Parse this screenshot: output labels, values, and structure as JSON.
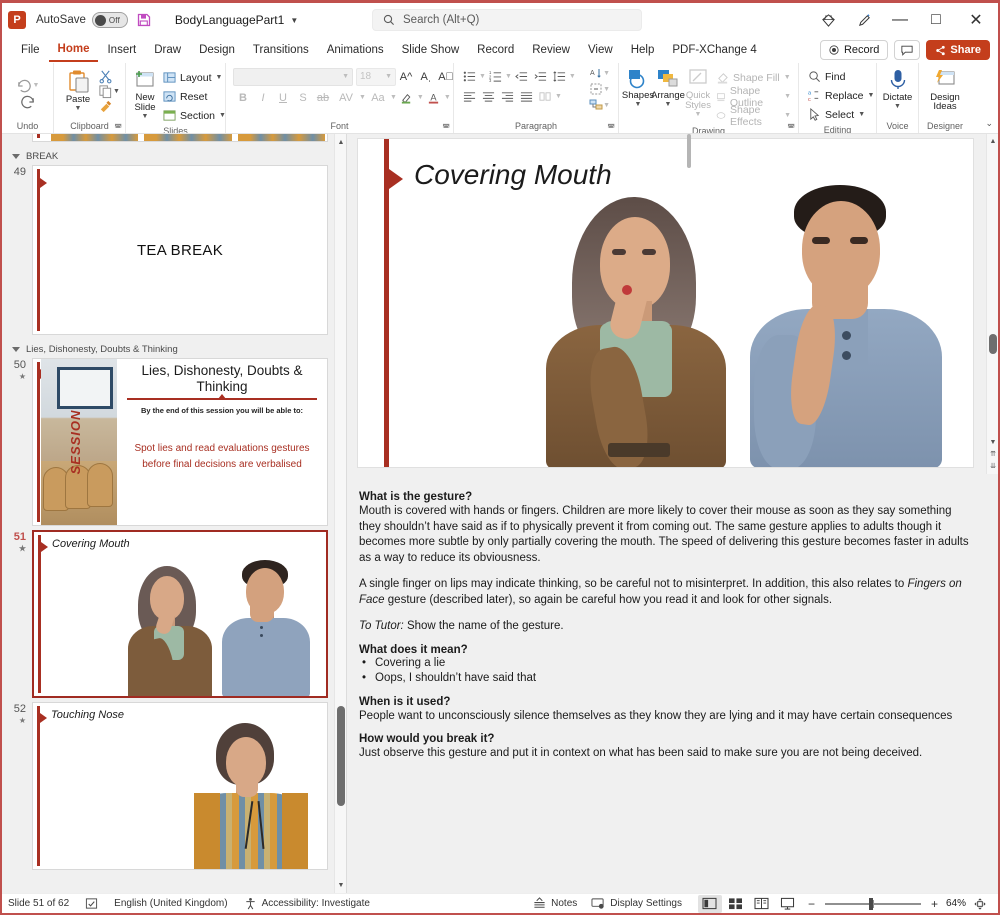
{
  "app": {
    "logo_text": "P",
    "autosave_label": "AutoSave",
    "autosave_state": "Off",
    "document_title": "BodyLanguagePart1",
    "accent_color": "#c43e1c",
    "slide_red": "#a82f22"
  },
  "search": {
    "placeholder": "Search (Alt+Q)"
  },
  "window_controls": {
    "diamond": "⬡",
    "pen": "✎",
    "minimize": "—",
    "maximize": "□",
    "close": "✕"
  },
  "ribbon": {
    "tabs": [
      "File",
      "Home",
      "Insert",
      "Draw",
      "Design",
      "Transitions",
      "Animations",
      "Slide Show",
      "Record",
      "Review",
      "View",
      "Help",
      "PDF-XChange 4"
    ],
    "active_tab": "Home",
    "record_label": "Record",
    "share_label": "Share",
    "collapse_caret": "⌄",
    "groups": [
      {
        "name": "Undo",
        "label": "Undo",
        "items": [
          "Undo",
          "Redo"
        ]
      },
      {
        "name": "Clipboard",
        "label": "Clipboard",
        "items": [
          "Paste",
          "Cut",
          "Copy",
          "Format Painter"
        ],
        "paste_label": "Paste"
      },
      {
        "name": "Slides",
        "label": "Slides",
        "new_slide_label": "New Slide",
        "items": [
          "Layout",
          "Reset",
          "Section"
        ]
      },
      {
        "name": "Font",
        "label": "Font",
        "font_name_value": "",
        "font_size_value": "18",
        "items": [
          "Increase Font Size",
          "Decrease Font Size",
          "Clear All Formatting",
          "Bold",
          "Italic",
          "Underline",
          "Text Shadow",
          "Strikethrough",
          "Character Spacing",
          "Change Case",
          "Text Highlight Color",
          "Font Color"
        ]
      },
      {
        "name": "Paragraph",
        "label": "Paragraph",
        "items": [
          "Bullets",
          "Numbering",
          "Decrease List Level",
          "Increase List Level",
          "Line Spacing",
          "Align Left",
          "Center",
          "Align Right",
          "Justify",
          "Columns",
          "Text Direction",
          "Align Text",
          "Convert to SmartArt"
        ]
      },
      {
        "name": "Drawing",
        "label": "Drawing",
        "shapes_label": "Shapes",
        "arrange_label": "Arrange",
        "quick_styles_label": "Quick Styles",
        "items": [
          "Shape Fill",
          "Shape Outline",
          "Shape Effects"
        ]
      },
      {
        "name": "Editing",
        "label": "Editing",
        "items": [
          "Find",
          "Replace",
          "Select"
        ]
      },
      {
        "name": "Voice",
        "label": "Voice",
        "dictate_label": "Dictate"
      },
      {
        "name": "Designer",
        "label": "Designer",
        "design_ideas_label": "Design Ideas"
      }
    ]
  },
  "slides_panel": {
    "sections": [
      {
        "title": "BREAK"
      },
      {
        "title": "Lies, Dishonesty, Doubts  & Thinking"
      }
    ],
    "thumbnails": [
      {
        "number": "49",
        "title": "",
        "center_text": "TEA BREAK",
        "starred": false,
        "selected": false
      },
      {
        "number": "50",
        "title": "Lies, Dishonesty, Doubts  & Thinking",
        "starred": true,
        "selected": false,
        "session_word": "SESSION",
        "subtitle": "By the end of this session you will be able to:",
        "objective": "Spot lies and read evaluations gestures before final decisions are verbalised"
      },
      {
        "number": "51",
        "title": "Covering Mouth",
        "starred": true,
        "selected": true
      },
      {
        "number": "52",
        "title": "Touching Nose",
        "starred": true,
        "selected": false
      }
    ]
  },
  "slide": {
    "title": "Covering Mouth"
  },
  "notes": {
    "blocks": [
      {
        "type": "heading",
        "text": "What is the gesture?"
      },
      {
        "type": "paragraph",
        "text": "Mouth is covered with hands or fingers. Children are more likely to cover their mouse as soon as they say something they shouldn’t have said as if to physically prevent it from coming out. The same gesture applies to adults though it becomes more subtle by only partially covering the mouth. The speed of delivering this gesture becomes faster in adults as a way to reduce its obviousness."
      },
      {
        "type": "spacer"
      },
      {
        "type": "paragraph_rich",
        "pre": "A single finger on lips may indicate thinking, so be careful not to misinterpret. In addition, this also relates to ",
        "em": "Fingers on Face",
        "post": " gesture (described later), so again be careful how you read it and look for other signals."
      },
      {
        "type": "spacer"
      },
      {
        "type": "paragraph_rich",
        "pre": "",
        "em": "To Tutor:",
        "post": " Show the name of the gesture."
      },
      {
        "type": "heading",
        "text": "What does it mean?"
      },
      {
        "type": "bullet",
        "text": "Covering a lie"
      },
      {
        "type": "bullet",
        "text": "Oops, I shouldn’t have said that"
      },
      {
        "type": "heading",
        "text": "When is it used?"
      },
      {
        "type": "paragraph",
        "text": "People want to unconsciously silence themselves as they know they are lying and it may have certain consequences"
      },
      {
        "type": "heading",
        "text": "How would you break it?"
      },
      {
        "type": "paragraph_justify",
        "text": "Just observe this gesture and put it in context on what has been said to make sure you are not being deceived."
      }
    ]
  },
  "statusbar": {
    "slide_counter": "Slide 51 of 62",
    "language": "English (United Kingdom)",
    "accessibility": "Accessibility: Investigate",
    "notes_label": "Notes",
    "display_settings_label": "Display Settings",
    "zoom_percent": "64%",
    "views": [
      "Normal",
      "Slide Sorter",
      "Reading View",
      "Slide Show"
    ],
    "zoom_out": "−",
    "zoom_in": "+"
  }
}
